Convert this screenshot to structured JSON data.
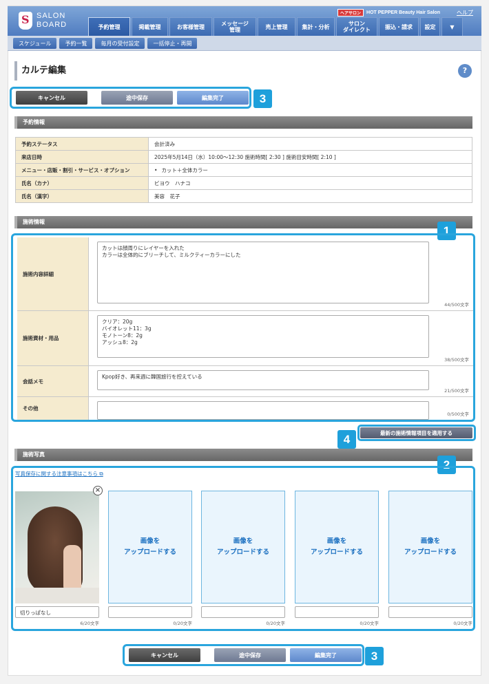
{
  "header": {
    "logo_top": "SALON",
    "logo_bottom": "BOARD",
    "brand_tag": "ヘアサロン",
    "brand_name": "HOT PEPPER Beauty Hair Salon",
    "help": "ヘルプ",
    "tabs": [
      {
        "label": "予約管理",
        "active": true
      },
      {
        "label": "掲載管理",
        "active": false
      },
      {
        "label": "お客様管理",
        "active": false
      },
      {
        "label": "メッセージ\n管理",
        "active": false
      },
      {
        "label": "売上管理",
        "active": false
      },
      {
        "label": "集計・分析",
        "active": false
      },
      {
        "label": "サロン\nダイレクト",
        "active": false
      },
      {
        "label": "振込・請求",
        "active": false
      },
      {
        "label": "設定",
        "active": false
      }
    ],
    "subnav": [
      "スケジュール",
      "予約一覧",
      "毎月の受付設定",
      "一括停止・再開"
    ]
  },
  "page": {
    "title": "カルテ編集",
    "help_icon": "?"
  },
  "actions": {
    "cancel": "キャンセル",
    "draft": "途中保存",
    "complete": "編集完了",
    "badge": "3"
  },
  "reservation": {
    "section_title": "予約情報",
    "rows": [
      {
        "label": "予約ステータス",
        "value": "会計済み"
      },
      {
        "label": "来店日時",
        "value": "2025年5月14日（水）10:00〜12:30 施術時間[ 2:30 ] 施術目安時間[ 2:10 ]"
      },
      {
        "label": "メニュー・店販・割引・サービス・オプション",
        "value": "カット＋全体カラー"
      },
      {
        "label": "氏名（カナ）",
        "value": "ビヨウ　ハナコ"
      },
      {
        "label": "氏名（漢字）",
        "value": "美容　花子"
      }
    ]
  },
  "treatment": {
    "section_title": "施術情報",
    "badge": "1",
    "rows": [
      {
        "label": "施術内容詳細",
        "text": "カットは顔周りにレイヤーを入れた\nカラーは全体的にブリーチして、ミルクティーカラーにした",
        "count": "44/500文字"
      },
      {
        "label": "施術資材・用品",
        "text": "クリア：20g\nバイオレット11：3g\nモノトーン8：2g\nアッシュ8：2g",
        "count": "38/500文字"
      },
      {
        "label": "会話メモ",
        "text": "Kpop好き、再来週に韓国旅行を控えている",
        "count": "21/500文字"
      },
      {
        "label": "その他",
        "text": "",
        "count": "0/500文字"
      }
    ],
    "apply_button": "最新の施術情報項目を適用する",
    "apply_badge": "4"
  },
  "photos": {
    "section_title": "施術写真",
    "badge": "2",
    "notice_link": "写真保存に関する注意事項はこちら",
    "upload_label": "画像を\nアップロードする",
    "items": [
      {
        "caption": "切りっぱなし",
        "count": "6/20文字"
      },
      {
        "caption": "",
        "count": "0/20文字"
      },
      {
        "caption": "",
        "count": "0/20文字"
      },
      {
        "caption": "",
        "count": "0/20文字"
      },
      {
        "caption": "",
        "count": "0/20文字"
      }
    ]
  }
}
